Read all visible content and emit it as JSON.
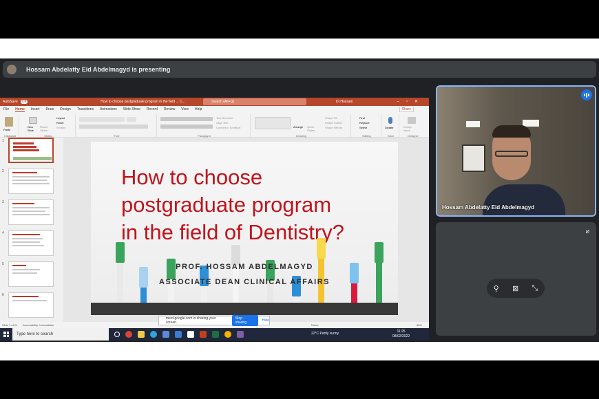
{
  "presenting_banner": "Hossam Abdelatty Eid Abdelmagyd is presenting",
  "powerpoint": {
    "autosave": "AutoSave",
    "autosave_state": "Off",
    "doc_title": "How to choose postgraduate program in the field ... C...",
    "search_placeholder": "Search (Alt+Q)",
    "user": "Dr.Hossam",
    "tabs": [
      "File",
      "Home",
      "Insert",
      "Draw",
      "Design",
      "Transitions",
      "Animations",
      "Slide Show",
      "Record",
      "Review",
      "View",
      "Help"
    ],
    "share_label": "Share",
    "ribbon_groups": [
      "Clipboard",
      "Slides",
      "Font",
      "Paragraph",
      "Drawing",
      "Editing",
      "Voice",
      "Designer"
    ],
    "ribbon_items": {
      "paste": "Paste",
      "new_slide": "New Slide",
      "reuse_slides": "Reuse Slides",
      "layout": "Layout",
      "reset": "Reset",
      "section": "Section",
      "text_direction": "Text Direction",
      "align_text": "Align Text",
      "convert_smartart": "Convert to SmartArt",
      "arrange": "Arrange",
      "quick_styles": "Quick Styles",
      "shape_fill": "Shape Fill",
      "shape_outline": "Shape Outline",
      "shape_effects": "Shape Effects",
      "find": "Find",
      "replace": "Replace",
      "select": "Select",
      "dictate": "Dictate",
      "design_ideas": "Design Ideas"
    },
    "thumb_numbers": [
      "1",
      "2",
      "3",
      "4",
      "5",
      "6"
    ],
    "slide": {
      "title_lines": [
        "How to choose",
        "postgraduate program",
        "in the field of Dentistry?"
      ],
      "presenter": "PROF. HOSSAM ABDELMAGYD",
      "role": "ASSOCIATE DEAN CLINICAL AFFAIRS"
    },
    "status": {
      "slide_count": "Slide 1 of 21",
      "accessibility": "Accessibility: Unavailable",
      "notes": "Notes",
      "zoom": "86%"
    }
  },
  "share_notice": {
    "text": "meet.google.com is sharing your screen.",
    "stop_label": "Stop sharing",
    "hide_label": "Hide"
  },
  "taskbar": {
    "search_placeholder": "Type here to search",
    "weather": "22°C  Partly sunny",
    "time": "11:25",
    "date": "08/02/2022"
  },
  "participant": {
    "name": "Hossam Abdelatty Eid Abdelmagyd"
  },
  "colors": {
    "meet_bg": "#202124",
    "ppt_accent": "#b7472a",
    "slide_title": "#c0141c",
    "meet_blue": "#1a73e8"
  }
}
